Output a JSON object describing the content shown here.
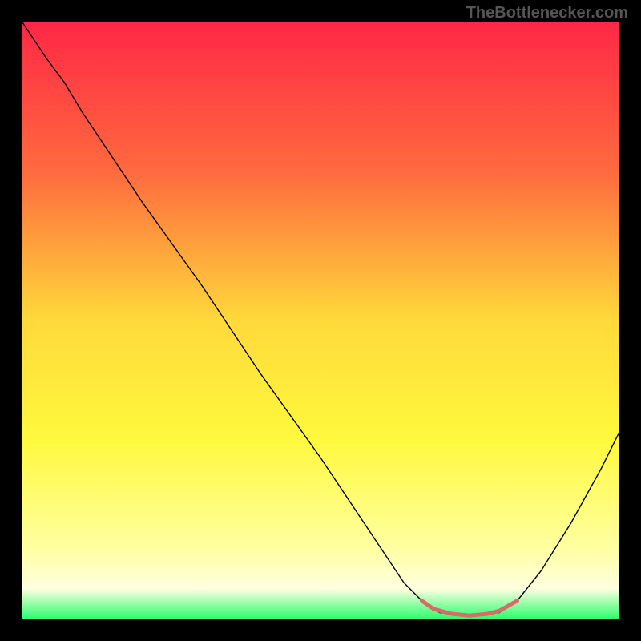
{
  "watermark": "TheBottlenecker.com",
  "chart_data": {
    "type": "line",
    "title": "",
    "xlabel": "",
    "ylabel": "",
    "xlim": [
      0,
      100
    ],
    "ylim": [
      0,
      100
    ],
    "background": {
      "type": "vertical-gradient",
      "stops": [
        {
          "offset": 0,
          "color": "#ff2846"
        },
        {
          "offset": 25,
          "color": "#ff6a3e"
        },
        {
          "offset": 50,
          "color": "#ffd93a"
        },
        {
          "offset": 70,
          "color": "#fff93d"
        },
        {
          "offset": 88,
          "color": "#ffffa0"
        },
        {
          "offset": 95,
          "color": "#ffffe0"
        },
        {
          "offset": 100,
          "color": "#2cff6e"
        }
      ]
    },
    "series": [
      {
        "name": "bottleneck-curve",
        "color": "#000000",
        "width": 1.4,
        "points": [
          {
            "x": 0,
            "y": 100
          },
          {
            "x": 4,
            "y": 94
          },
          {
            "x": 7,
            "y": 90
          },
          {
            "x": 10,
            "y": 85
          },
          {
            "x": 20,
            "y": 70
          },
          {
            "x": 30,
            "y": 56
          },
          {
            "x": 40,
            "y": 41
          },
          {
            "x": 50,
            "y": 27
          },
          {
            "x": 56,
            "y": 18
          },
          {
            "x": 60,
            "y": 12
          },
          {
            "x": 64,
            "y": 6
          },
          {
            "x": 67,
            "y": 3
          },
          {
            "x": 70,
            "y": 1
          },
          {
            "x": 75,
            "y": 0.5
          },
          {
            "x": 80,
            "y": 1
          },
          {
            "x": 83,
            "y": 3
          },
          {
            "x": 87,
            "y": 8
          },
          {
            "x": 92,
            "y": 16
          },
          {
            "x": 97,
            "y": 25
          },
          {
            "x": 100,
            "y": 31
          }
        ]
      },
      {
        "name": "sweet-spot-highlight",
        "color": "#d86a6a",
        "width": 5,
        "points": [
          {
            "x": 67,
            "y": 3
          },
          {
            "x": 69,
            "y": 1.6
          },
          {
            "x": 72,
            "y": 0.8
          },
          {
            "x": 75,
            "y": 0.5
          },
          {
            "x": 78,
            "y": 0.8
          },
          {
            "x": 80,
            "y": 1.3
          },
          {
            "x": 83,
            "y": 3
          }
        ]
      }
    ]
  }
}
